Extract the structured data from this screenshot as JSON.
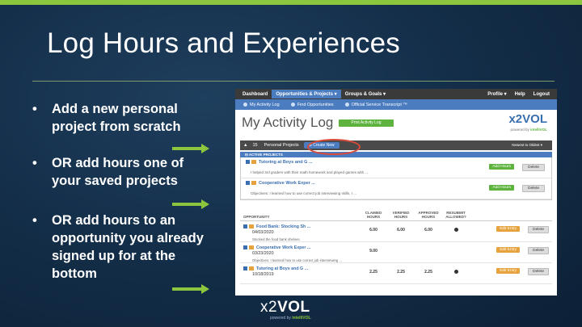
{
  "slide": {
    "title": "Log Hours and Experiences",
    "bullets": [
      "Add a new personal project from scratch",
      "OR add hours one of your saved projects",
      "OR add hours to an opportunity you already signed up for at the bottom"
    ]
  },
  "app": {
    "topnav": [
      "Dashboard",
      "Opportunities & Projects ▾",
      "Groups & Goals ▾"
    ],
    "topnav_right": [
      "Profile ▾",
      "Help",
      "Logout"
    ],
    "subnav": [
      "My Activity Log",
      "Find Opportunities",
      "Official Service Transcript ™"
    ],
    "page_title": "My Activity Log",
    "print_button": "Print Activity Log",
    "logo": "x2VOL",
    "logo_sub_prefix": "powered by",
    "logo_sub_brand": "intelliVOL",
    "projects_bar": {
      "count": "15",
      "label": "Personal Projects",
      "create_button": "⊕ Create New",
      "sort": "Newest to Oldest"
    },
    "active_projects_label": "ACTIVE PROJECTS",
    "projects": [
      {
        "title": "Tutoring at Boys and G ...",
        "desc": "I helped 3rd graders with their math homework and played games with ...",
        "add": "Add Hours",
        "del": "Delete"
      },
      {
        "title": "Cooperative Work Exper ...",
        "desc": "Objectives: I learned how to use correct job interviewing skills. I ...",
        "add": "Add Hours",
        "del": "Delete"
      }
    ],
    "opp_headers": [
      "OPPORTUNITY",
      "CLAIMED HOURS",
      "VERIFIED HOURS",
      "APPROVED HOURS",
      "RESUBMIT ALLOWED?"
    ],
    "opportunities": [
      {
        "name": "Food Bank: Stocking Sh ...",
        "date": "04/03/2020",
        "desc": "Stocked the food bank shelves.",
        "claimed": "6.00",
        "verified": "6.00",
        "approved": "6.00",
        "resubmit": true,
        "edit": "Edit Entry",
        "del": "Delete"
      },
      {
        "name": "Cooperative Work Exper ...",
        "date": "03/23/2020",
        "desc": "Objectives: I learned how to use correct job interviewing ...",
        "claimed": "9.00",
        "verified": "",
        "approved": "",
        "resubmit": false,
        "edit": "Edit Entry",
        "del": "Delete"
      },
      {
        "name": "Tutoring at Boys and G ...",
        "date": "10/18/2019",
        "desc": "",
        "claimed": "2.25",
        "verified": "2.25",
        "approved": "2.25",
        "resubmit": true,
        "edit": "Edit Entry",
        "del": "Delete"
      }
    ]
  },
  "footer": {
    "logo_x2": "x2",
    "logo_vol": "VOL",
    "sub_prefix": "powered by",
    "sub_brand": "intelliVOL"
  },
  "colors": {
    "accent_green": "#8cc63f",
    "app_blue": "#4a7cbf",
    "highlight_red": "#d94a3a"
  }
}
